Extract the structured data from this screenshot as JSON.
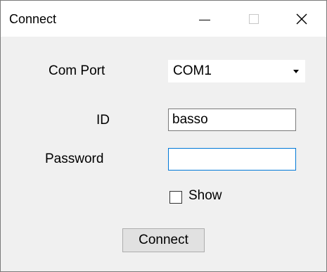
{
  "window": {
    "title": "Connect"
  },
  "form": {
    "com_port": {
      "label": "Com Port",
      "value": "COM1"
    },
    "id": {
      "label": "ID",
      "value": "basso"
    },
    "password": {
      "label": "Password",
      "value": ""
    },
    "show": {
      "label": "Show",
      "checked": false
    },
    "connect_label": "Connect"
  },
  "icons": [
    "minimize-icon",
    "maximize-icon",
    "close-icon",
    "dropdown-arrow-icon"
  ]
}
